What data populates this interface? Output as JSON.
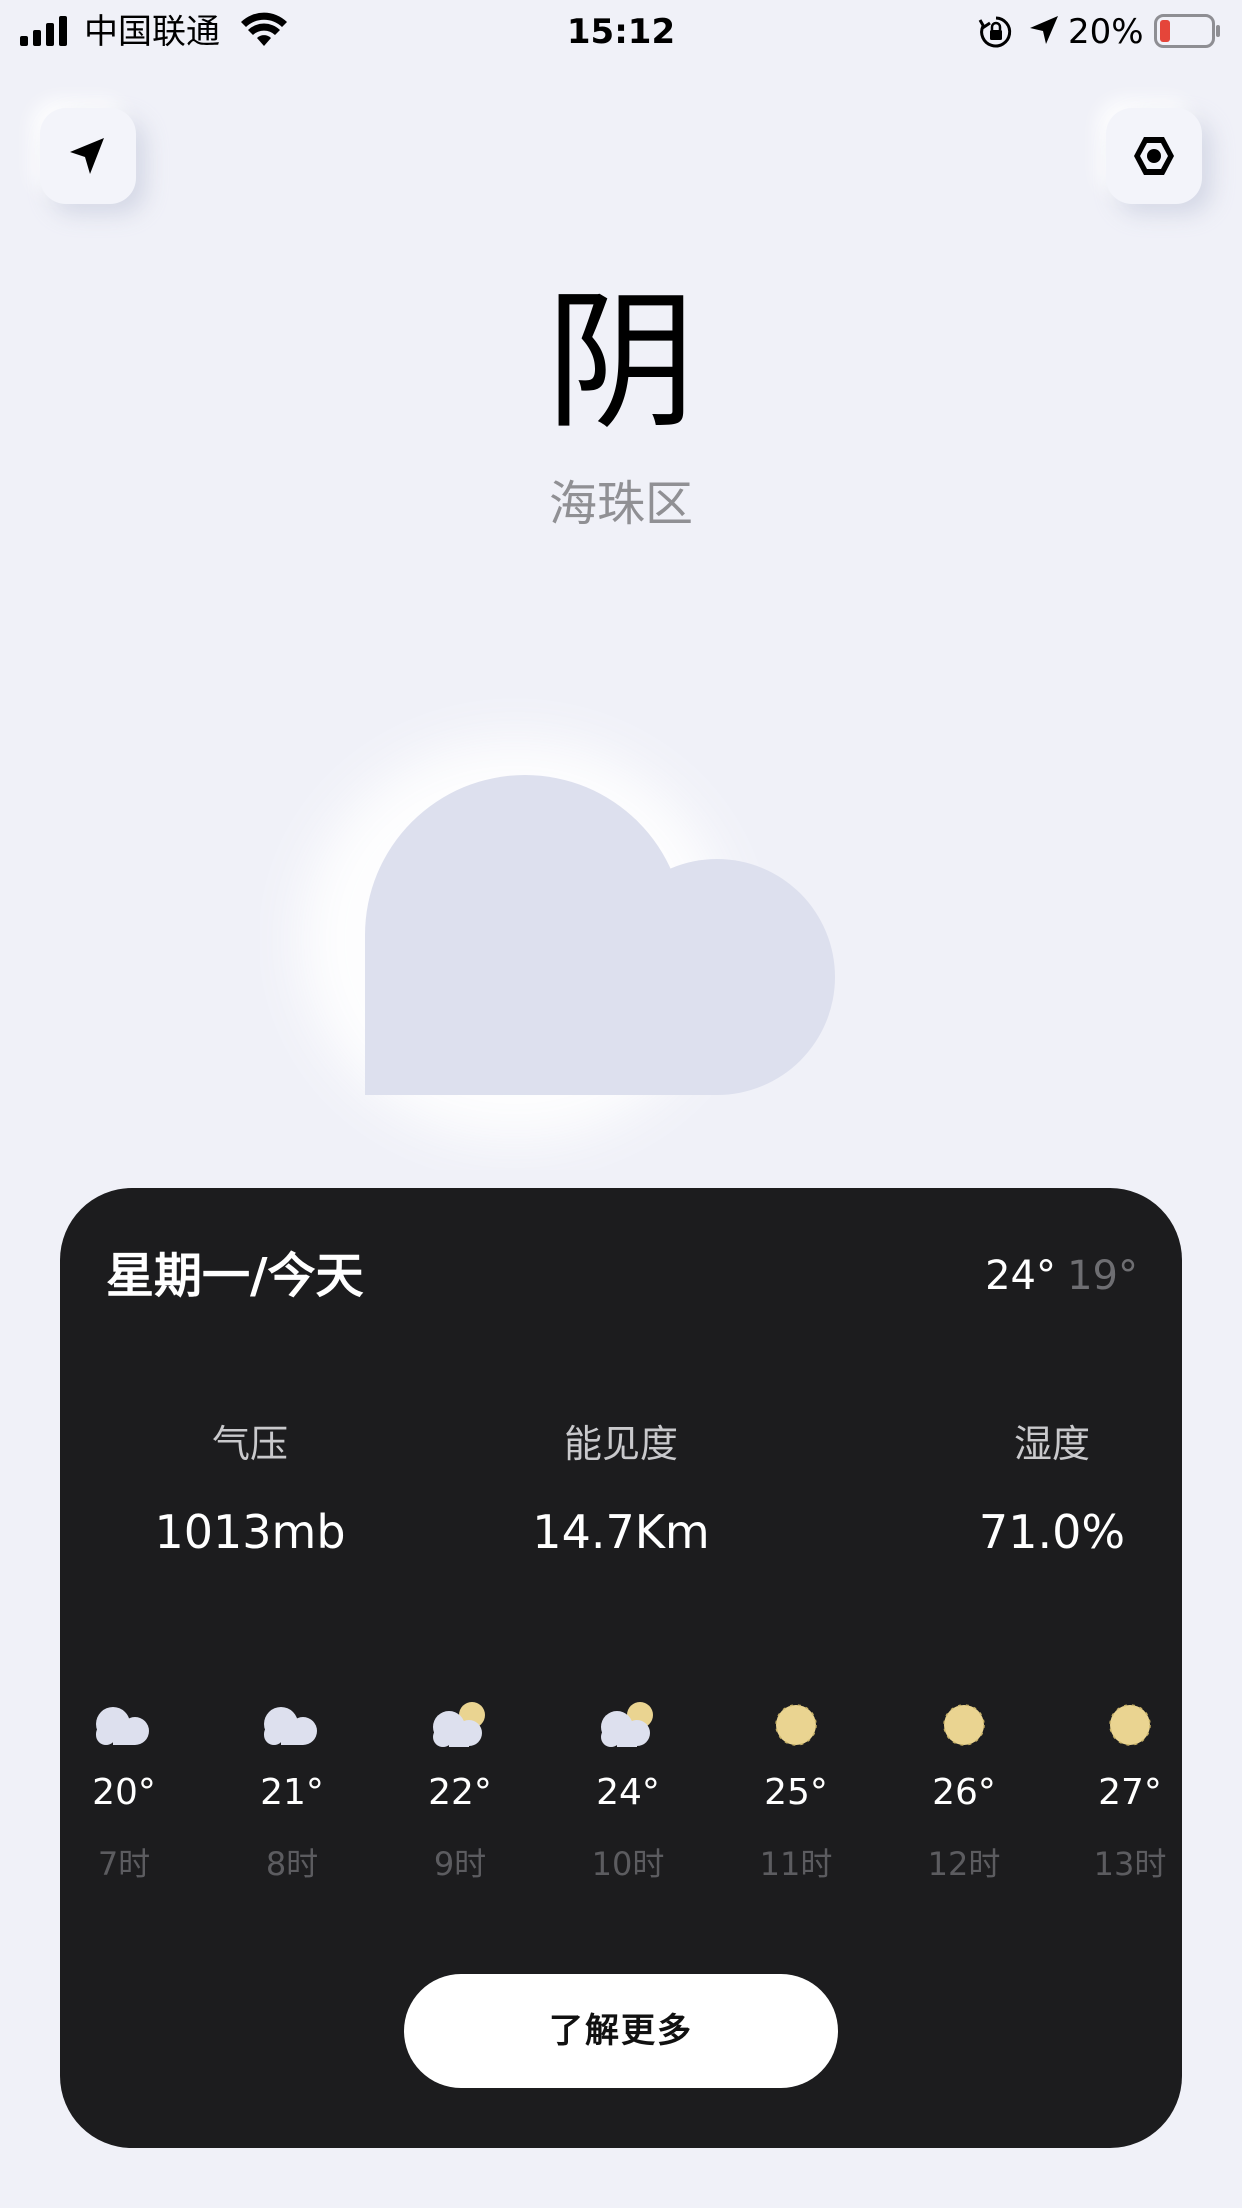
{
  "status_bar": {
    "carrier": "中国联通",
    "time": "15:12",
    "battery_percent": "20%",
    "battery_level": 0.2,
    "battery_color": "#e5453a"
  },
  "top_buttons": {
    "left_icon": "location-arrow-icon",
    "right_icon": "hexagon-settings-icon"
  },
  "weather": {
    "condition": "阴",
    "location": "海珠区",
    "main_icon": "cloud-icon"
  },
  "card": {
    "day_label": "星期一/今天",
    "temp_high": "24°",
    "temp_low": "19°",
    "stats": [
      {
        "label": "气压",
        "value": "1013mb"
      },
      {
        "label": "能见度",
        "value": "14.7Km"
      },
      {
        "label": "湿度",
        "value": "71.0%"
      }
    ],
    "hourly": [
      {
        "icon": "cloud-icon",
        "temp": "20°",
        "time": "7时"
      },
      {
        "icon": "cloud-icon",
        "temp": "21°",
        "time": "8时"
      },
      {
        "icon": "partly-cloudy-icon",
        "temp": "22°",
        "time": "9时"
      },
      {
        "icon": "partly-cloudy-icon",
        "temp": "24°",
        "time": "10时"
      },
      {
        "icon": "sun-icon",
        "temp": "25°",
        "time": "11时"
      },
      {
        "icon": "sun-icon",
        "temp": "26°",
        "time": "12时"
      },
      {
        "icon": "sun-icon",
        "temp": "27°",
        "time": "13时"
      }
    ],
    "more_button": "了解更多"
  },
  "colors": {
    "background": "#f0f1f8",
    "card": "#1c1c1e",
    "cloud": "#dde0ee",
    "sun": "#ead491"
  }
}
